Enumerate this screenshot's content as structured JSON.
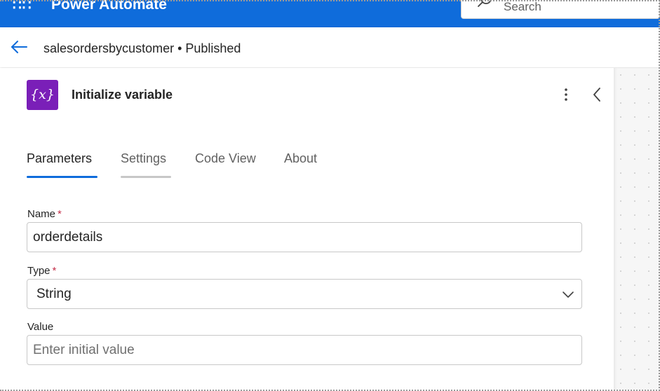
{
  "app": {
    "title": "Power Automate",
    "waffle_glyph": "∷∷",
    "search_placeholder": "Search"
  },
  "flow": {
    "title": "salesordersbycustomer • Published"
  },
  "action": {
    "icon_text": "{x}",
    "icon_color": "#7a1fb8",
    "title": "Initialize variable"
  },
  "tabs": [
    {
      "label": "Parameters",
      "active": true
    },
    {
      "label": "Settings",
      "active": false
    },
    {
      "label": "Code View",
      "active": false
    },
    {
      "label": "About",
      "active": false
    }
  ],
  "fields": {
    "name": {
      "label": "Name",
      "required_marker": "*",
      "value": "orderdetails"
    },
    "type": {
      "label": "Type",
      "required_marker": "*",
      "value": "String"
    },
    "value": {
      "label": "Value",
      "placeholder": "Enter initial value"
    }
  },
  "colors": {
    "brand": "#0f6cdb",
    "tab_active_underline": "#0f6cdb",
    "tab_hover_underline": "#c7c7c7",
    "required": "#c4314b"
  }
}
